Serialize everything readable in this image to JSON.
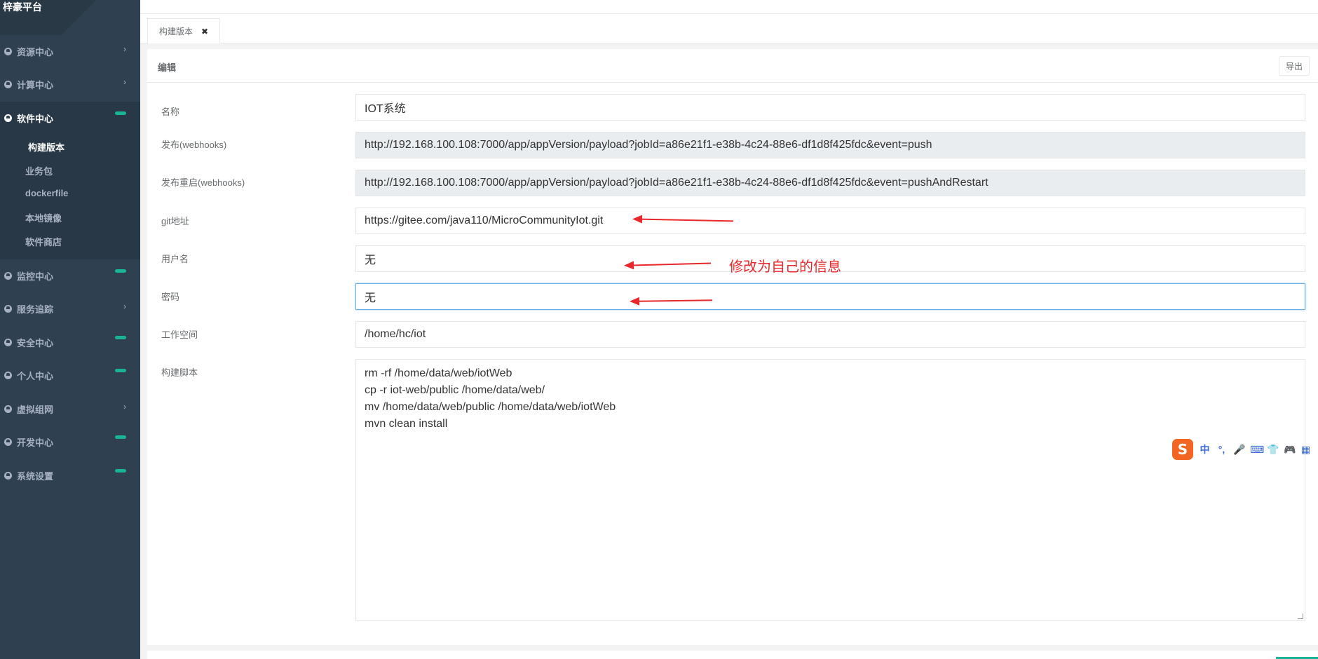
{
  "brand": {
    "title": "梓豪平台"
  },
  "sidebar": {
    "items": [
      {
        "label": "资源中心",
        "indicator": "chevron"
      },
      {
        "label": "计算中心",
        "indicator": "chevron"
      },
      {
        "label": "软件中心",
        "indicator": "pill",
        "active": true
      },
      {
        "label": "监控中心",
        "indicator": "pill"
      },
      {
        "label": "服务追踪",
        "indicator": "chevron"
      },
      {
        "label": "安全中心",
        "indicator": "pill"
      },
      {
        "label": "个人中心",
        "indicator": "pill"
      },
      {
        "label": "虚拟组网",
        "indicator": "chevron"
      },
      {
        "label": "开发中心",
        "indicator": "pill"
      },
      {
        "label": "系统设置",
        "indicator": "pill"
      }
    ],
    "submenu": [
      "构建版本",
      "业务包",
      "dockerfile",
      "本地镜像",
      "软件商店"
    ],
    "active_submenu": "构建版本",
    "chevron_glyph": "›"
  },
  "tabs": [
    {
      "label": "构建版本",
      "close": "✖"
    }
  ],
  "panel": {
    "title": "编辑",
    "export_label": "导出"
  },
  "form": {
    "name": {
      "label": "名称",
      "value": "IOT系统"
    },
    "webhook": {
      "label": "发布(webhooks)",
      "value": "http://192.168.100.108:7000/app/appVersion/payload?jobId=a86e21f1-e38b-4c24-88e6-df1d8f425fdc&event=push"
    },
    "webhook_restart": {
      "label": "发布重启(webhooks)",
      "value": "http://192.168.100.108:7000/app/appVersion/payload?jobId=a86e21f1-e38b-4c24-88e6-df1d8f425fdc&event=pushAndRestart"
    },
    "git": {
      "label": "git地址",
      "value": "https://gitee.com/java110/MicroCommunityIot.git"
    },
    "username": {
      "label": "用户名",
      "value": "无"
    },
    "password": {
      "label": "密码",
      "value": "无"
    },
    "workspace": {
      "label": "工作空间",
      "value": "/home/hc/iot"
    },
    "script": {
      "label": "构建脚本",
      "value": "rm -rf /home/data/web/iotWeb\ncp -r iot-web/public /home/data/web/\nmv /home/data/web/public /home/data/web/iotWeb\nmvn clean install"
    }
  },
  "annotation": {
    "text": "修改为自己的信息",
    "color": "#e8282b"
  },
  "ime": {
    "logo": "S",
    "buttons": [
      "中",
      "°,",
      "🎤",
      "⌨",
      "👕",
      "🎮",
      "▦"
    ]
  },
  "colors": {
    "sidebar": "#2f4050",
    "accent": "#1ab394"
  }
}
